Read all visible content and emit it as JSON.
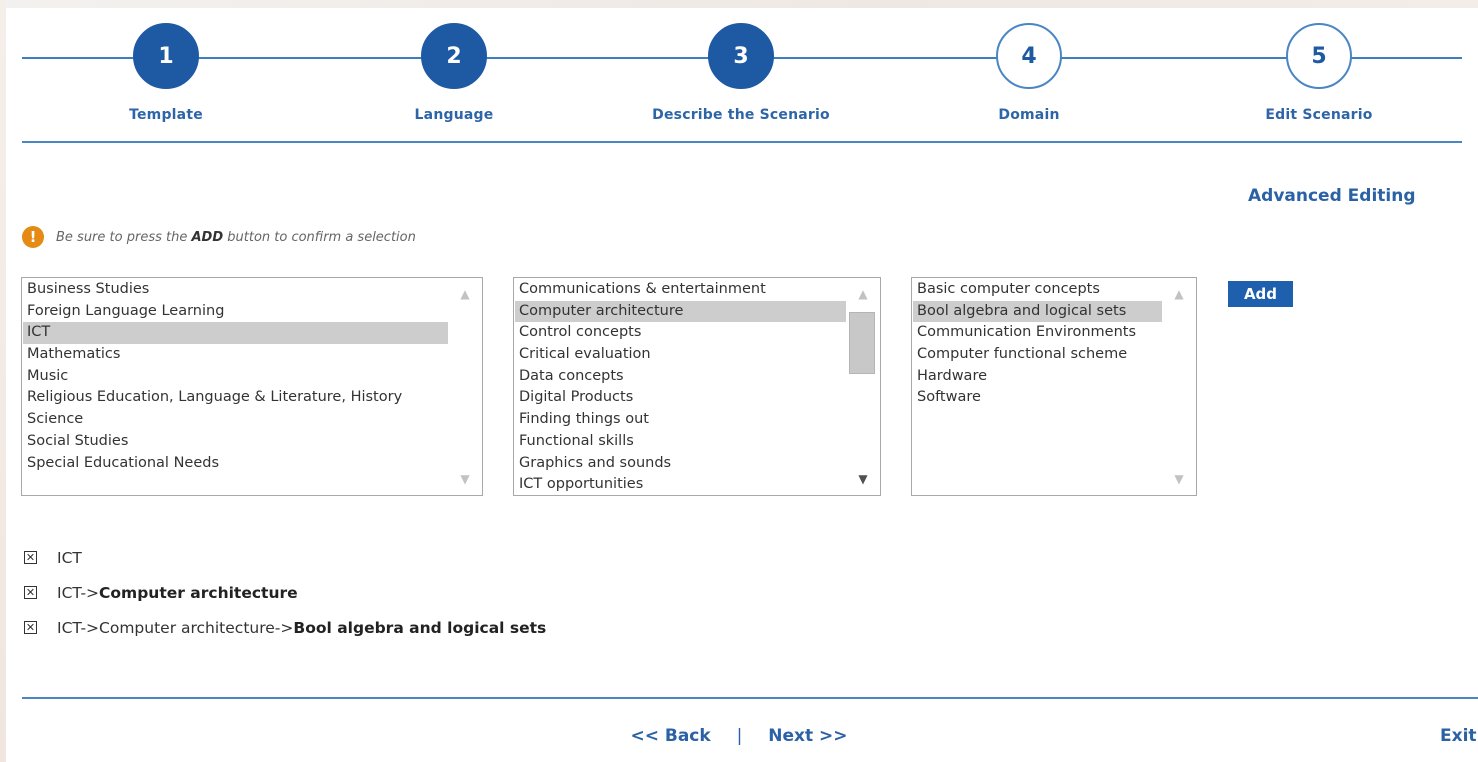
{
  "wizard": {
    "steps": [
      {
        "number": "1",
        "label": "Template",
        "state": "completed"
      },
      {
        "number": "2",
        "label": "Language",
        "state": "completed"
      },
      {
        "number": "3",
        "label": "Describe the Scenario",
        "state": "completed"
      },
      {
        "number": "4",
        "label": "Domain",
        "state": "pending"
      },
      {
        "number": "5",
        "label": "Edit Scenario",
        "state": "pending"
      }
    ]
  },
  "advanced_editing_label": "Advanced Editing",
  "hint": {
    "icon": "warning-icon",
    "icon_glyph": "!",
    "pre": "Be sure to press the ",
    "emphasis": "ADD",
    "post": " button to confirm a selection"
  },
  "subjects": {
    "options": [
      "Business Studies",
      "Foreign Language Learning",
      "ICT",
      "Mathematics",
      "Music",
      "Religious Education, Language & Literature, History",
      "Science",
      "Social Studies",
      "Special Educational Needs"
    ],
    "selected_index": 2
  },
  "topics": {
    "options": [
      "Communications & entertainment",
      "Computer architecture",
      "Control concepts",
      "Critical evaluation",
      "Data concepts",
      "Digital Products",
      "Finding things out",
      "Functional skills",
      "Graphics and sounds",
      "ICT opportunities"
    ],
    "selected_index": 1
  },
  "subtopics": {
    "options": [
      "Basic computer concepts",
      "Bool algebra and logical sets",
      "Communication Environments",
      "Computer functional scheme",
      "Hardware",
      "Software"
    ],
    "selected_index": 1
  },
  "add_button_label": "Add",
  "selections": [
    {
      "remove_glyph": "✕",
      "prefix": "ICT",
      "bold": ""
    },
    {
      "remove_glyph": "✕",
      "prefix": "ICT->",
      "bold": "Computer architecture"
    },
    {
      "remove_glyph": "✕",
      "prefix": "ICT->Computer architecture->",
      "bold": "Bool algebra and logical sets"
    }
  ],
  "footer": {
    "back_label": "<< Back",
    "separator": "|",
    "next_label": "Next >>",
    "exit_label": "Exit"
  },
  "colors": {
    "accent": "#1e5aa3",
    "link": "#2b62a6",
    "warning": "#e58a12",
    "selection_bg": "#cdcdcd"
  }
}
